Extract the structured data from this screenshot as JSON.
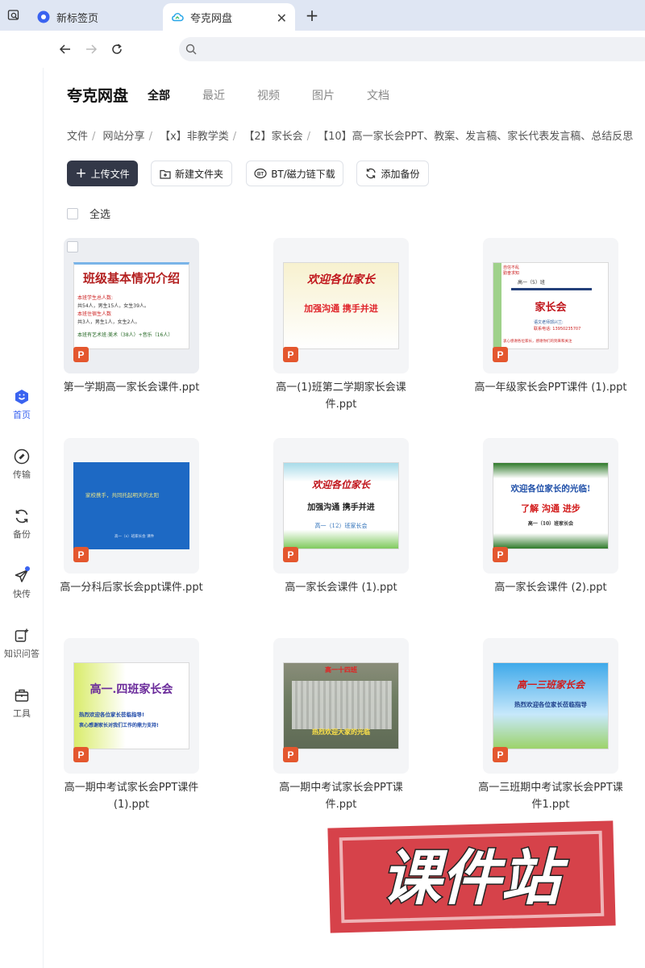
{
  "browser": {
    "tabs": [
      {
        "label": "新标签页"
      },
      {
        "label": "夸克网盘"
      }
    ]
  },
  "rail": [
    {
      "label": "首页"
    },
    {
      "label": "传输"
    },
    {
      "label": "备份"
    },
    {
      "label": "快传"
    },
    {
      "label": "知识问答"
    },
    {
      "label": "工具"
    }
  ],
  "header": {
    "brand": "夸克网盘",
    "filter_tabs": [
      "全部",
      "最近",
      "视频",
      "图片",
      "文档"
    ]
  },
  "breadcrumb": [
    "文件",
    "网站分享",
    "【x】非教学类",
    "【2】家长会",
    "【10】高一家长会PPT、教案、发言稿、家长代表发言稿、总结反思"
  ],
  "toolbar": {
    "upload": "上传文件",
    "new_folder": "新建文件夹",
    "bt": "BT/磁力链下载",
    "backup": "添加备份"
  },
  "select_all": "全选",
  "files": [
    {
      "name": "第一学期高一家长会课件.ppt"
    },
    {
      "name": "高一(1)班第二学期家长会课件.ppt"
    },
    {
      "name": "高一年级家长会PPT课件 (1).ppt"
    },
    {
      "name": "高一分科后家长会ppt课件.ppt"
    },
    {
      "name": "高一家长会课件 (1).ppt"
    },
    {
      "name": "高一家长会课件 (2).ppt"
    },
    {
      "name": "高一期中考试家长会PPT课件 (1).ppt"
    },
    {
      "name": "高一期中考试家长会PPT课件.ppt"
    },
    {
      "name": "高一三班期中考试家长会PPT课件1.ppt"
    }
  ],
  "file_badge": "P",
  "thumbs": {
    "t1": {
      "title": "班级基本情况介绍",
      "l1": "本班学生总人数:",
      "l2": "共54人，男生15人，女生39人。",
      "l3": "本班住宿生人数",
      "l4": "共3人，男生1人，女生2人。",
      "l5": "本班有艺术班:美术（38人）+音乐（16人）"
    },
    "t2": {
      "title": "欢迎各位家长",
      "sub": "加强沟通 携手并进"
    },
    "t3": {
      "tag1": "自信不乱",
      "tag2": "勤奋求知",
      "cls": "高一（5）班",
      "title": "家长会",
      "teacher": "语文老师郭兴兰:",
      "phone": "联系电话: 13950235707",
      "bottom": "衷心感谢各位家长，感谢你们的到来和关注"
    },
    "t4": {
      "title": "家校携手，共同托起明天的太阳",
      "bottom": "高一（x）班家长会 课件"
    },
    "t5": {
      "title": "欢迎各位家长",
      "sub": "加强沟通 携手并进",
      "cls": "高一（12）班家长会"
    },
    "t6": {
      "title": "欢迎各位家长的光临!",
      "sub": "了解 沟通 进步",
      "cls": "高一（10）班家长会"
    },
    "t7": {
      "title": "高一.四班家长会",
      "l1": "热烈欢迎各位家长莅临指导!",
      "l2": "衷心感谢家长对我们工作的鼎力支持!"
    },
    "t8": {
      "banner": "高一十四班",
      "sub": "热烈欢迎大家的光临"
    },
    "t9": {
      "title": "高一三班家长会",
      "sub": "热烈欢迎各位家长莅临指导"
    }
  },
  "watermark": "课件站",
  "colors": {
    "accent": "#3a63f0",
    "primary_btn": "#333848",
    "ppt_badge": "#e4572e",
    "stamp": "#d6424a"
  }
}
